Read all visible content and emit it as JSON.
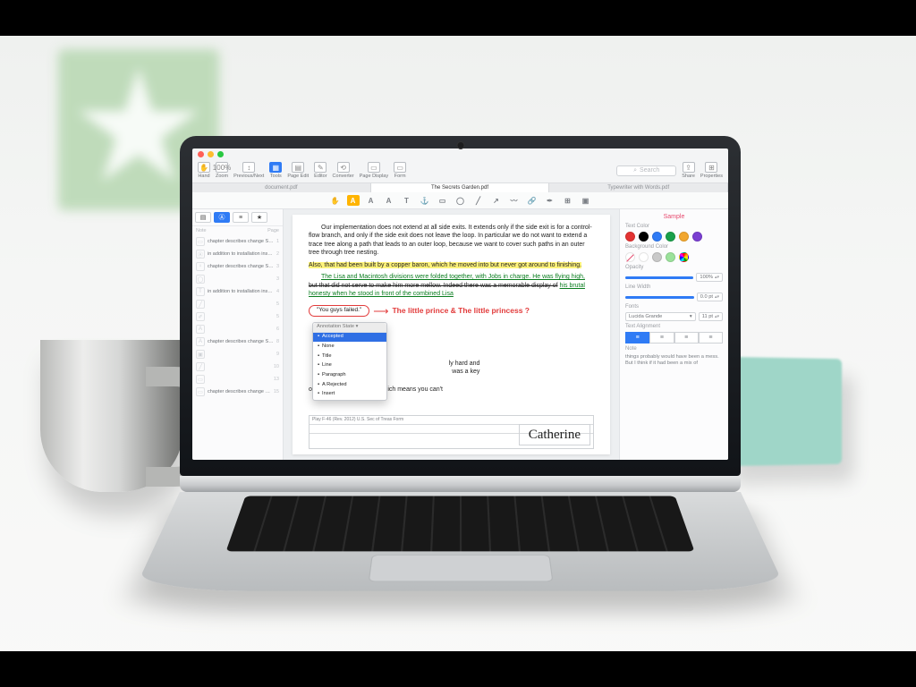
{
  "toolbar": {
    "items": [
      {
        "name": "hand",
        "icon": "✋",
        "label": "Hand"
      },
      {
        "name": "zoom",
        "icon": "100%",
        "label": "Zoom"
      },
      {
        "name": "prevnext",
        "icon": "↕",
        "label": "Previous/Next"
      },
      {
        "name": "tools",
        "icon": "▦",
        "label": "Tools",
        "active": true
      },
      {
        "name": "page-edit",
        "icon": "▤",
        "label": "Page Edit"
      },
      {
        "name": "editor",
        "icon": "✎",
        "label": "Editor"
      },
      {
        "name": "converter",
        "icon": "⟲",
        "label": "Converter"
      },
      {
        "name": "page-display",
        "icon": "▭",
        "label": "Page Display"
      },
      {
        "name": "form",
        "icon": "▭",
        "label": "Form"
      }
    ],
    "search_label": "Search",
    "share": "Share",
    "properties": "Properties"
  },
  "tabs": [
    {
      "name": "tab-1",
      "label": "document.pdf",
      "active": false
    },
    {
      "name": "tab-2",
      "label": "The Secrets Garden.pdf",
      "active": true
    },
    {
      "name": "tab-3",
      "label": "Typewriter with Words.pdf",
      "active": false
    }
  ],
  "annotate_tools": [
    {
      "n": "hand",
      "g": "✋"
    },
    {
      "n": "highlight",
      "g": "A",
      "hl": true
    },
    {
      "n": "strike",
      "g": "A"
    },
    {
      "n": "underline",
      "g": "A"
    },
    {
      "n": "text",
      "g": "T"
    },
    {
      "n": "anchor",
      "g": "⚓"
    },
    {
      "n": "rect",
      "g": "▭"
    },
    {
      "n": "oval",
      "g": "◯"
    },
    {
      "n": "line",
      "g": "╱"
    },
    {
      "n": "arrow",
      "g": "↗"
    },
    {
      "n": "ink",
      "g": "〰"
    },
    {
      "n": "link",
      "g": "🔗"
    },
    {
      "n": "sign",
      "g": "✒"
    },
    {
      "n": "stamp",
      "g": "⊞"
    },
    {
      "n": "image",
      "g": "▣"
    }
  ],
  "sidebar": {
    "header_note": "Note",
    "header_page": "Page",
    "rows": [
      {
        "t": "chapter describes change Sho…",
        "p": "1"
      },
      {
        "t": "in addition to installation instru…",
        "p": "2"
      },
      {
        "t": "chapter describes change Sho…",
        "p": "3"
      },
      {
        "t": "",
        "p": "3"
      },
      {
        "t": "in addition to installation instru…",
        "p": "4"
      },
      {
        "t": "",
        "p": "5"
      },
      {
        "t": "",
        "p": "5"
      },
      {
        "t": "",
        "p": "6"
      },
      {
        "t": "chapter describes change Sho…",
        "p": "8"
      },
      {
        "t": "",
        "p": "9"
      },
      {
        "t": "",
        "p": "10"
      },
      {
        "t": "",
        "p": "13"
      },
      {
        "t": "chapter describes change Sho…",
        "p": "15"
      }
    ],
    "tool_icons": [
      "▭",
      "Ⓐ",
      "♀",
      "◯",
      "T",
      "╱",
      "✐",
      "A",
      "A",
      "▣",
      "╱",
      "▭"
    ]
  },
  "doc": {
    "p1": "Our implementation does not extend at all side exits. It extends only if the side exit is for a control-flow branch, and only if the side exit does not leave the loop. In particular we do not want to extend a trace tree along a path that leads to an outer loop, because we want to cover such paths in an outer tree through tree nesting.",
    "hl": "Also, that had been built by a copper baron, which he moved into but never got around to finishing.",
    "green": "The Lisa and Macintosh divisions were folded together, with Jobs in charge. He was flying high,",
    "strike": "but that did not serve to make him more mellow. Indeed there was a memorable display of",
    "green2": "his brutal honesty when he stood in front of the combined Lisa",
    "callout": "\"You guys failed.\"",
    "headline": "The little prince & The little princess ?",
    "p3a": "ly hard and",
    "p3b": "was a key",
    "p4": "only with other A players, which means you can't",
    "form_label": "Play F-46 (Rev. 2012)  U.S. Sec of Treas Form",
    "signature": "Catherine",
    "context": {
      "title": "Annotation State ▾",
      "items": [
        "Accepted",
        "None",
        "Title",
        "Line",
        "Paragraph",
        "A Rejected",
        "Insert"
      ]
    }
  },
  "insp": {
    "title": "Sample",
    "text_color": "Text Color",
    "bg_color": "Background Color",
    "opacity": "Opacity",
    "opacity_val": "100%",
    "line_width": "Line Width",
    "line_val": "0.0 pt",
    "fonts": "Fonts",
    "font_name": "Lucida Grande",
    "font_size": "11 pt",
    "align": "Text Alignment",
    "note": "Note",
    "note_body": "things probably would have been a mess. But I think if it had been a mix of",
    "colors": [
      "#e23232",
      "#000000",
      "#2f7bf5",
      "#1aa04a",
      "#f2a72e",
      "#7a3fd1"
    ],
    "bg_colors": [
      "none",
      "#ffffff",
      "#c9c9c9",
      "#9be29b",
      "rainbow"
    ]
  }
}
